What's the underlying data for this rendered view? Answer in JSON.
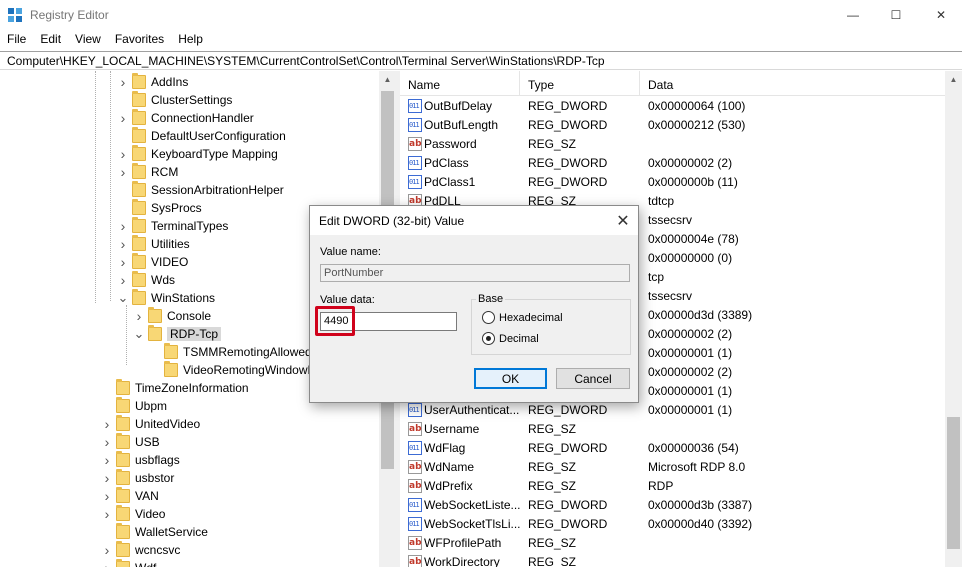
{
  "window": {
    "title": "Registry Editor",
    "icon": "registry-editor-icon",
    "minimize_glyph": "—",
    "maximize_glyph": "☐",
    "close_glyph": "✕"
  },
  "menu": [
    "File",
    "Edit",
    "View",
    "Favorites",
    "Help"
  ],
  "address": "Computer\\HKEY_LOCAL_MACHINE\\SYSTEM\\CurrentControlSet\\Control\\Terminal Server\\WinStations\\RDP-Tcp",
  "tree": [
    {
      "label": "AddIns",
      "depth": 1,
      "expander": "collapsed"
    },
    {
      "label": "ClusterSettings",
      "depth": 1,
      "expander": "none"
    },
    {
      "label": "ConnectionHandler",
      "depth": 1,
      "expander": "collapsed"
    },
    {
      "label": "DefaultUserConfiguration",
      "depth": 1,
      "expander": "none"
    },
    {
      "label": "KeyboardType Mapping",
      "depth": 1,
      "expander": "collapsed"
    },
    {
      "label": "RCM",
      "depth": 1,
      "expander": "collapsed"
    },
    {
      "label": "SessionArbitrationHelper",
      "depth": 1,
      "expander": "none"
    },
    {
      "label": "SysProcs",
      "depth": 1,
      "expander": "none"
    },
    {
      "label": "TerminalTypes",
      "depth": 1,
      "expander": "collapsed"
    },
    {
      "label": "Utilities",
      "depth": 1,
      "expander": "collapsed"
    },
    {
      "label": "VIDEO",
      "depth": 1,
      "expander": "collapsed"
    },
    {
      "label": "Wds",
      "depth": 1,
      "expander": "collapsed"
    },
    {
      "label": "WinStations",
      "depth": 1,
      "expander": "expanded"
    },
    {
      "label": "Console",
      "depth": 2,
      "expander": "collapsed"
    },
    {
      "label": "RDP-Tcp",
      "depth": 2,
      "expander": "expanded",
      "selected": true
    },
    {
      "label": "TSMMRemotingAllowedAp",
      "depth": 3,
      "expander": "none"
    },
    {
      "label": "VideoRemotingWindowNa",
      "depth": 3,
      "expander": "none"
    },
    {
      "label": "TimeZoneInformation",
      "depth": 0,
      "expander": "none"
    },
    {
      "label": "Ubpm",
      "depth": 0,
      "expander": "none"
    },
    {
      "label": "UnitedVideo",
      "depth": 0,
      "expander": "collapsed"
    },
    {
      "label": "USB",
      "depth": 0,
      "expander": "collapsed"
    },
    {
      "label": "usbflags",
      "depth": 0,
      "expander": "collapsed"
    },
    {
      "label": "usbstor",
      "depth": 0,
      "expander": "collapsed"
    },
    {
      "label": "VAN",
      "depth": 0,
      "expander": "collapsed"
    },
    {
      "label": "Video",
      "depth": 0,
      "expander": "collapsed"
    },
    {
      "label": "WalletService",
      "depth": 0,
      "expander": "none"
    },
    {
      "label": "wcncsvc",
      "depth": 0,
      "expander": "collapsed"
    },
    {
      "label": "Wdf",
      "depth": 0,
      "expander": "collapsed"
    }
  ],
  "list": {
    "headers": {
      "name": "Name",
      "type": "Type",
      "data": "Data"
    },
    "rows": [
      {
        "name": "OutBufDelay",
        "type": "REG_DWORD",
        "data": "0x00000064 (100)",
        "icon": "dword"
      },
      {
        "name": "OutBufLength",
        "type": "REG_DWORD",
        "data": "0x00000212 (530)",
        "icon": "dword"
      },
      {
        "name": "Password",
        "type": "REG_SZ",
        "data": "",
        "icon": "sz"
      },
      {
        "name": "PdClass",
        "type": "REG_DWORD",
        "data": "0x00000002 (2)",
        "icon": "dword"
      },
      {
        "name": "PdClass1",
        "type": "REG_DWORD",
        "data": "0x0000000b (11)",
        "icon": "dword"
      },
      {
        "name": "PdDLL",
        "type": "REG_SZ",
        "data": "tdtcp",
        "icon": "sz"
      },
      {
        "name": "",
        "type": "",
        "data": "tssecsrv",
        "icon": "none"
      },
      {
        "name": "",
        "type": "",
        "data": "0x0000004e (78)",
        "icon": "none"
      },
      {
        "name": "",
        "type": "",
        "data": "0x00000000 (0)",
        "icon": "none"
      },
      {
        "name": "",
        "type": "",
        "data": "tcp",
        "icon": "none"
      },
      {
        "name": "",
        "type": "",
        "data": "tssecsrv",
        "icon": "none"
      },
      {
        "name": "",
        "type": "",
        "data": "0x00000d3d (3389)",
        "icon": "none"
      },
      {
        "name": "",
        "type": "",
        "data": "0x00000002 (2)",
        "icon": "none"
      },
      {
        "name": "",
        "type": "",
        "data": "0x00000001 (1)",
        "icon": "none"
      },
      {
        "name": "",
        "type": "",
        "data": "0x00000002 (2)",
        "icon": "none"
      },
      {
        "name": "",
        "type": "",
        "data": "0x00000001 (1)",
        "icon": "none"
      },
      {
        "name": "UserAuthenticat...",
        "type": "REG_DWORD",
        "data": "0x00000001 (1)",
        "icon": "dword"
      },
      {
        "name": "Username",
        "type": "REG_SZ",
        "data": "",
        "icon": "sz"
      },
      {
        "name": "WdFlag",
        "type": "REG_DWORD",
        "data": "0x00000036 (54)",
        "icon": "dword"
      },
      {
        "name": "WdName",
        "type": "REG_SZ",
        "data": "Microsoft RDP 8.0",
        "icon": "sz"
      },
      {
        "name": "WdPrefix",
        "type": "REG_SZ",
        "data": "RDP",
        "icon": "sz"
      },
      {
        "name": "WebSocketListe...",
        "type": "REG_DWORD",
        "data": "0x00000d3b (3387)",
        "icon": "dword"
      },
      {
        "name": "WebSocketTlsLi...",
        "type": "REG_DWORD",
        "data": "0x00000d40 (3392)",
        "icon": "dword"
      },
      {
        "name": "WFProfilePath",
        "type": "REG_SZ",
        "data": "",
        "icon": "sz"
      },
      {
        "name": "WorkDirectory",
        "type": "REG_SZ",
        "data": "",
        "icon": "sz"
      }
    ]
  },
  "dialog": {
    "title": "Edit DWORD (32-bit) Value",
    "value_name_label": "Value name:",
    "value_name": "PortNumber",
    "value_data_label": "Value data:",
    "value_data": "4490",
    "base_label": "Base",
    "base_options": [
      {
        "label": "Hexadecimal",
        "checked": false
      },
      {
        "label": "Decimal",
        "checked": true
      }
    ],
    "ok_label": "OK",
    "cancel_label": "Cancel",
    "highlight_color": "#d0021b"
  },
  "icons": {
    "string_value": "ab",
    "dword_value": "011"
  }
}
